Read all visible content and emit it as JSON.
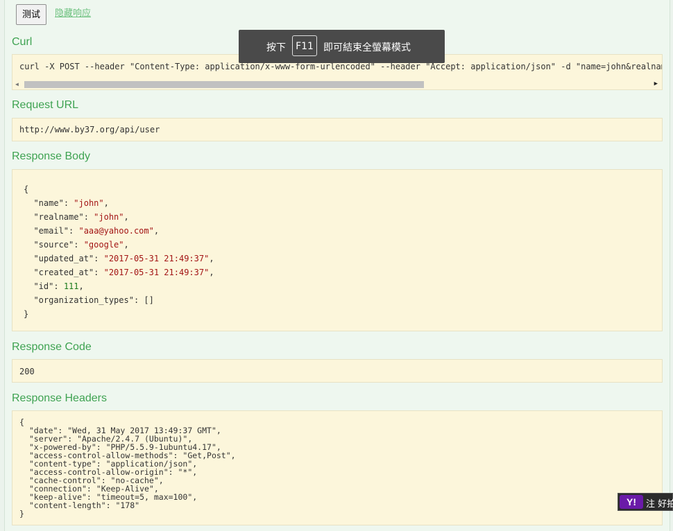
{
  "actions": {
    "test_button": "测试",
    "hide_response": "隐藏响应"
  },
  "sections": {
    "curl": "Curl",
    "request_url": "Request URL",
    "response_body": "Response Body",
    "response_code": "Response Code",
    "response_headers": "Response Headers"
  },
  "curl_command": "curl -X POST --header \"Content-Type: application/x-www-form-urlencoded\" --header \"Accept: application/json\" -d \"name=john&realname",
  "request_url": "http://www.by37.org/api/user",
  "response_body": {
    "open": "{",
    "close": "}",
    "fields": [
      {
        "key": "\"name\"",
        "value": "\"john\"",
        "type": "string",
        "comma": ","
      },
      {
        "key": "\"realname\"",
        "value": "\"john\"",
        "type": "string",
        "comma": ","
      },
      {
        "key": "\"email\"",
        "value": "\"aaa@yahoo.com\"",
        "type": "string",
        "comma": ","
      },
      {
        "key": "\"source\"",
        "value": "\"google\"",
        "type": "string",
        "comma": ","
      },
      {
        "key": "\"updated_at\"",
        "value": "\"2017-05-31 21:49:37\"",
        "type": "string",
        "comma": ","
      },
      {
        "key": "\"created_at\"",
        "value": "\"2017-05-31 21:49:37\"",
        "type": "string",
        "comma": ","
      },
      {
        "key": "\"id\"",
        "value": "111",
        "type": "number",
        "comma": ","
      },
      {
        "key": "\"organization_types\"",
        "value": "[]",
        "type": "plain",
        "comma": ""
      }
    ]
  },
  "response_code": "200",
  "response_headers_lines": [
    "{",
    "  \"date\": \"Wed, 31 May 2017 13:49:37 GMT\",",
    "  \"server\": \"Apache/2.4.7 (Ubuntu)\",",
    "  \"x-powered-by\": \"PHP/5.5.9-1ubuntu4.17\",",
    "  \"access-control-allow-methods\": \"Get,Post\",",
    "  \"content-type\": \"application/json\",",
    "  \"access-control-allow-origin\": \"*\",",
    "  \"cache-control\": \"no-cache\",",
    "  \"connection\": \"Keep-Alive\",",
    "  \"keep-alive\": \"timeout=5, max=100\",",
    "  \"content-length\": \"178\"",
    "}"
  ],
  "fullscreen_toast": {
    "pre": "按下",
    "key": "F11",
    "post": "即可結束全螢幕模式"
  },
  "yahoo_widget": {
    "logo": "Y!",
    "text": "注 好拍"
  }
}
